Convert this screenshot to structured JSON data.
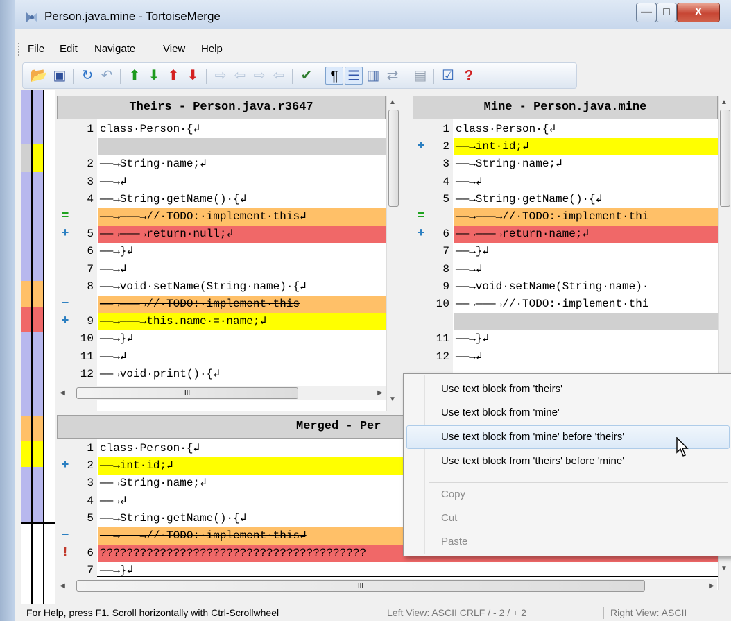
{
  "window": {
    "title": "Person.java.mine - TortoiseMerge",
    "minimize": "—",
    "maximize": "□",
    "close": "X"
  },
  "menu": [
    "File",
    "Edit",
    "Navigate",
    "View",
    "Help"
  ],
  "toolbar": {
    "icons": [
      "open-icon",
      "save-icon",
      "reload-icon",
      "undo-icon",
      "prev-diff-icon",
      "next-diff-icon",
      "prev-conflict-icon",
      "next-conflict-icon",
      "use-theirs-block-icon",
      "use-mine-block-icon",
      "use-theirs-then-mine-icon",
      "use-mine-then-theirs-icon",
      "mark-resolved-icon",
      "show-whitespace-icon",
      "inline-diff-icon",
      "one-pane-icon",
      "two-pane-icon",
      "ignore-whitespace-icon",
      "mark-conflict-resolved-icon",
      "help-icon"
    ]
  },
  "theirs": {
    "header": "Theirs - Person.java.r3647",
    "lines": [
      {
        "n": "1",
        "m": "",
        "t": "class·Person·{↲",
        "bg": "#ffffff",
        "s": false
      },
      {
        "n": "",
        "m": "",
        "t": "",
        "bg": "#d0d0d0",
        "s": false
      },
      {
        "n": "2",
        "m": "",
        "t": "——→String·name;↲",
        "bg": "#ffffff",
        "s": false
      },
      {
        "n": "3",
        "m": "",
        "t": "——→↲",
        "bg": "#ffffff",
        "s": false
      },
      {
        "n": "4",
        "m": "",
        "t": "——→String·getName()·{↲",
        "bg": "#ffffff",
        "s": false
      },
      {
        "n": "",
        "m": "=",
        "t": "——→———→//·TODO:·implement·this↲",
        "bg": "#ffc068",
        "s": true
      },
      {
        "n": "5",
        "m": "+",
        "t": "——→———→return·null;↲",
        "bg": "#f06868",
        "s": false
      },
      {
        "n": "6",
        "m": "",
        "t": "——→}↲",
        "bg": "#ffffff",
        "s": false
      },
      {
        "n": "7",
        "m": "",
        "t": "——→↲",
        "bg": "#ffffff",
        "s": false
      },
      {
        "n": "8",
        "m": "",
        "t": "——→void·setName(String·name)·{↲",
        "bg": "#ffffff",
        "s": false
      },
      {
        "n": "",
        "m": "−",
        "t": "——→———→//·TODO:·implement·this",
        "bg": "#ffc068",
        "s": true
      },
      {
        "n": "9",
        "m": "+",
        "t": "——→———→this.name·=·name;↲",
        "bg": "#ffff00",
        "s": false
      },
      {
        "n": "10",
        "m": "",
        "t": "——→}↲",
        "bg": "#ffffff",
        "s": false
      },
      {
        "n": "11",
        "m": "",
        "t": "——→↲",
        "bg": "#ffffff",
        "s": false
      },
      {
        "n": "12",
        "m": "",
        "t": "——→void·print()·{↲",
        "bg": "#ffffff",
        "s": false
      }
    ]
  },
  "mine": {
    "header": "Mine - Person.java.mine",
    "lines": [
      {
        "n": "1",
        "m": "",
        "t": "class·Person·{↲",
        "bg": "#ffffff",
        "s": false
      },
      {
        "n": "2",
        "m": "+",
        "t": "——→int·id;↲",
        "bg": "#ffff00",
        "s": false
      },
      {
        "n": "3",
        "m": "",
        "t": "——→String·name;↲",
        "bg": "#ffffff",
        "s": false
      },
      {
        "n": "4",
        "m": "",
        "t": "——→↲",
        "bg": "#ffffff",
        "s": false
      },
      {
        "n": "5",
        "m": "",
        "t": "——→String·getName()·{↲",
        "bg": "#ffffff",
        "s": false
      },
      {
        "n": "",
        "m": "=",
        "t": "——→———→//·TODO:·implement·thi",
        "bg": "#ffc068",
        "s": true
      },
      {
        "n": "6",
        "m": "+",
        "t": "——→———→return·name;↲",
        "bg": "#f06868",
        "s": false
      },
      {
        "n": "7",
        "m": "",
        "t": "——→}↲",
        "bg": "#ffffff",
        "s": false
      },
      {
        "n": "8",
        "m": "",
        "t": "——→↲",
        "bg": "#ffffff",
        "s": false
      },
      {
        "n": "9",
        "m": "",
        "t": "——→void·setName(String·name)·",
        "bg": "#ffffff",
        "s": false
      },
      {
        "n": "10",
        "m": "",
        "t": "——→———→//·TODO:·implement·thi",
        "bg": "#ffffff",
        "s": false
      },
      {
        "n": "",
        "m": "",
        "t": "",
        "bg": "#d0d0d0",
        "s": false
      },
      {
        "n": "11",
        "m": "",
        "t": "——→}↲",
        "bg": "#ffffff",
        "s": false
      },
      {
        "n": "12",
        "m": "",
        "t": "——→↲",
        "bg": "#ffffff",
        "s": false
      }
    ]
  },
  "merged": {
    "header": "Merged - Per",
    "lines": [
      {
        "n": "1",
        "m": "",
        "t": "class·Person·{↲",
        "bg": "#ffffff",
        "s": false
      },
      {
        "n": "2",
        "m": "+",
        "t": "——→int·id;↲",
        "bg": "#ffff00",
        "s": false
      },
      {
        "n": "3",
        "m": "",
        "t": "——→String·name;↲",
        "bg": "#ffffff",
        "s": false
      },
      {
        "n": "4",
        "m": "",
        "t": "——→↲",
        "bg": "#ffffff",
        "s": false
      },
      {
        "n": "5",
        "m": "",
        "t": "——→String·getName()·{↲",
        "bg": "#ffffff",
        "s": false
      },
      {
        "n": "",
        "m": "−",
        "t": "——→———→//·TODO:·implement·this↲",
        "bg": "#ffc068",
        "s": true
      },
      {
        "n": "6",
        "m": "!",
        "t": "????????????????????????????????????????",
        "bg": "#f06868",
        "s": false
      },
      {
        "n": "7",
        "m": "",
        "t": "——→}↲",
        "bg": "#ffffff",
        "s": false
      }
    ]
  },
  "context_menu": {
    "items": [
      "Use text block from 'theirs'",
      "Use text block from 'mine'",
      "Use text block from 'mine' before 'theirs'",
      "Use text block from 'theirs' before 'mine'"
    ],
    "edit_items": [
      "Copy",
      "Cut",
      "Paste"
    ]
  },
  "status": {
    "help": "For Help, press F1. Scroll horizontally with Ctrl-Scrollwheel",
    "left_view": "Left View: ASCII CRLF  / - 2 / + 2",
    "right_view": "Right View: ASCII"
  },
  "scroll": {
    "hthumb": "III"
  },
  "colors": {
    "conflict": "#f06868",
    "modified": "#ffc068",
    "added": "#ffff00",
    "empty": "#d0d0d0",
    "locator": "#b8b8ee"
  }
}
